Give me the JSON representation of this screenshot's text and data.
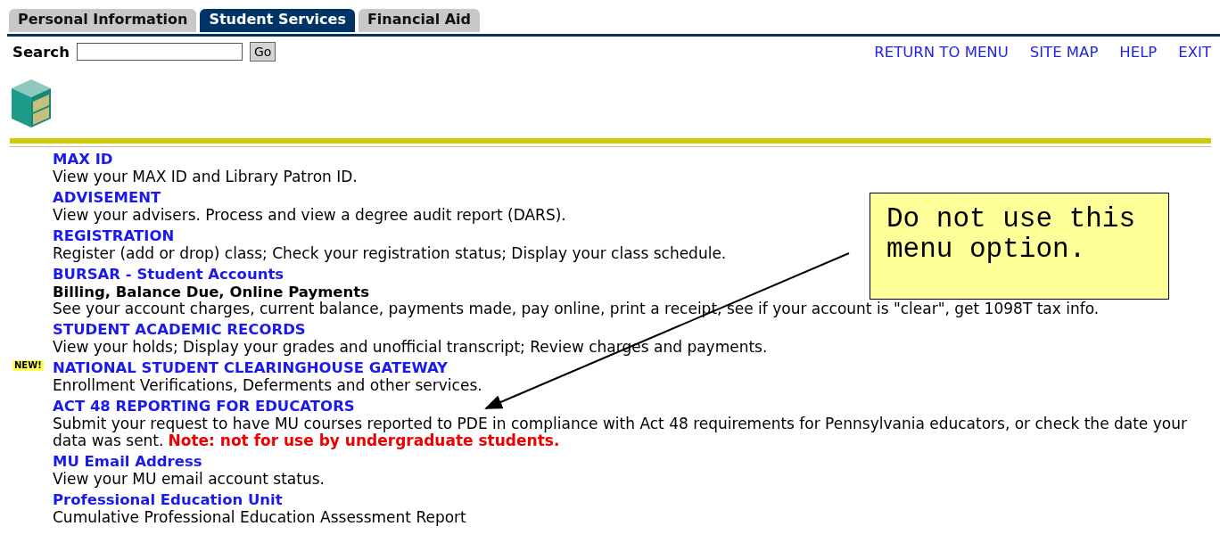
{
  "tabs": [
    {
      "label": "Personal Information",
      "selected": false
    },
    {
      "label": "Student Services",
      "selected": true
    },
    {
      "label": "Financial Aid",
      "selected": false
    }
  ],
  "search": {
    "label": "Search",
    "button": "Go"
  },
  "nav_links": [
    "RETURN TO MENU",
    "SITE MAP",
    "HELP",
    "EXIT"
  ],
  "menu_items": [
    {
      "title": "MAX ID",
      "description": "View your MAX ID and Library Patron ID."
    },
    {
      "title": "ADVISEMENT",
      "description": "View your advisers. Process and view a degree audit report (DARS)."
    },
    {
      "title": "REGISTRATION",
      "description": "Register (add or drop) class; Check your registration status; Display your class schedule."
    },
    {
      "title": "BURSAR - Student Accounts",
      "subtitle": "Billing, Balance Due, Online Payments",
      "description": "See your account charges, current balance, payments made, pay online, print a receipt, see if your account is \"clear\", get 1098T tax info."
    },
    {
      "title": "STUDENT ACADEMIC RECORDS",
      "description": "View your holds; Display your grades and unofficial transcript; Review charges and payments."
    },
    {
      "title": "NATIONAL STUDENT CLEARINGHOUSE GATEWAY",
      "badge": "NEW!",
      "description": "Enrollment Verifications, Deferments and other services."
    },
    {
      "title": "ACT 48 REPORTING FOR EDUCATORS",
      "description": "Submit your request to have MU courses reported to PDE in compliance with Act 48 requirements for Pennsylvania educators, or check the date your data was sent.",
      "note": "Note: not for use by undergraduate students."
    },
    {
      "title": "MU Email Address",
      "description": "View your MU email account status."
    },
    {
      "title": "Professional Education Unit",
      "description": "Cumulative Professional Education Assessment Report"
    }
  ],
  "callout": {
    "text": "Do not use this menu option."
  }
}
